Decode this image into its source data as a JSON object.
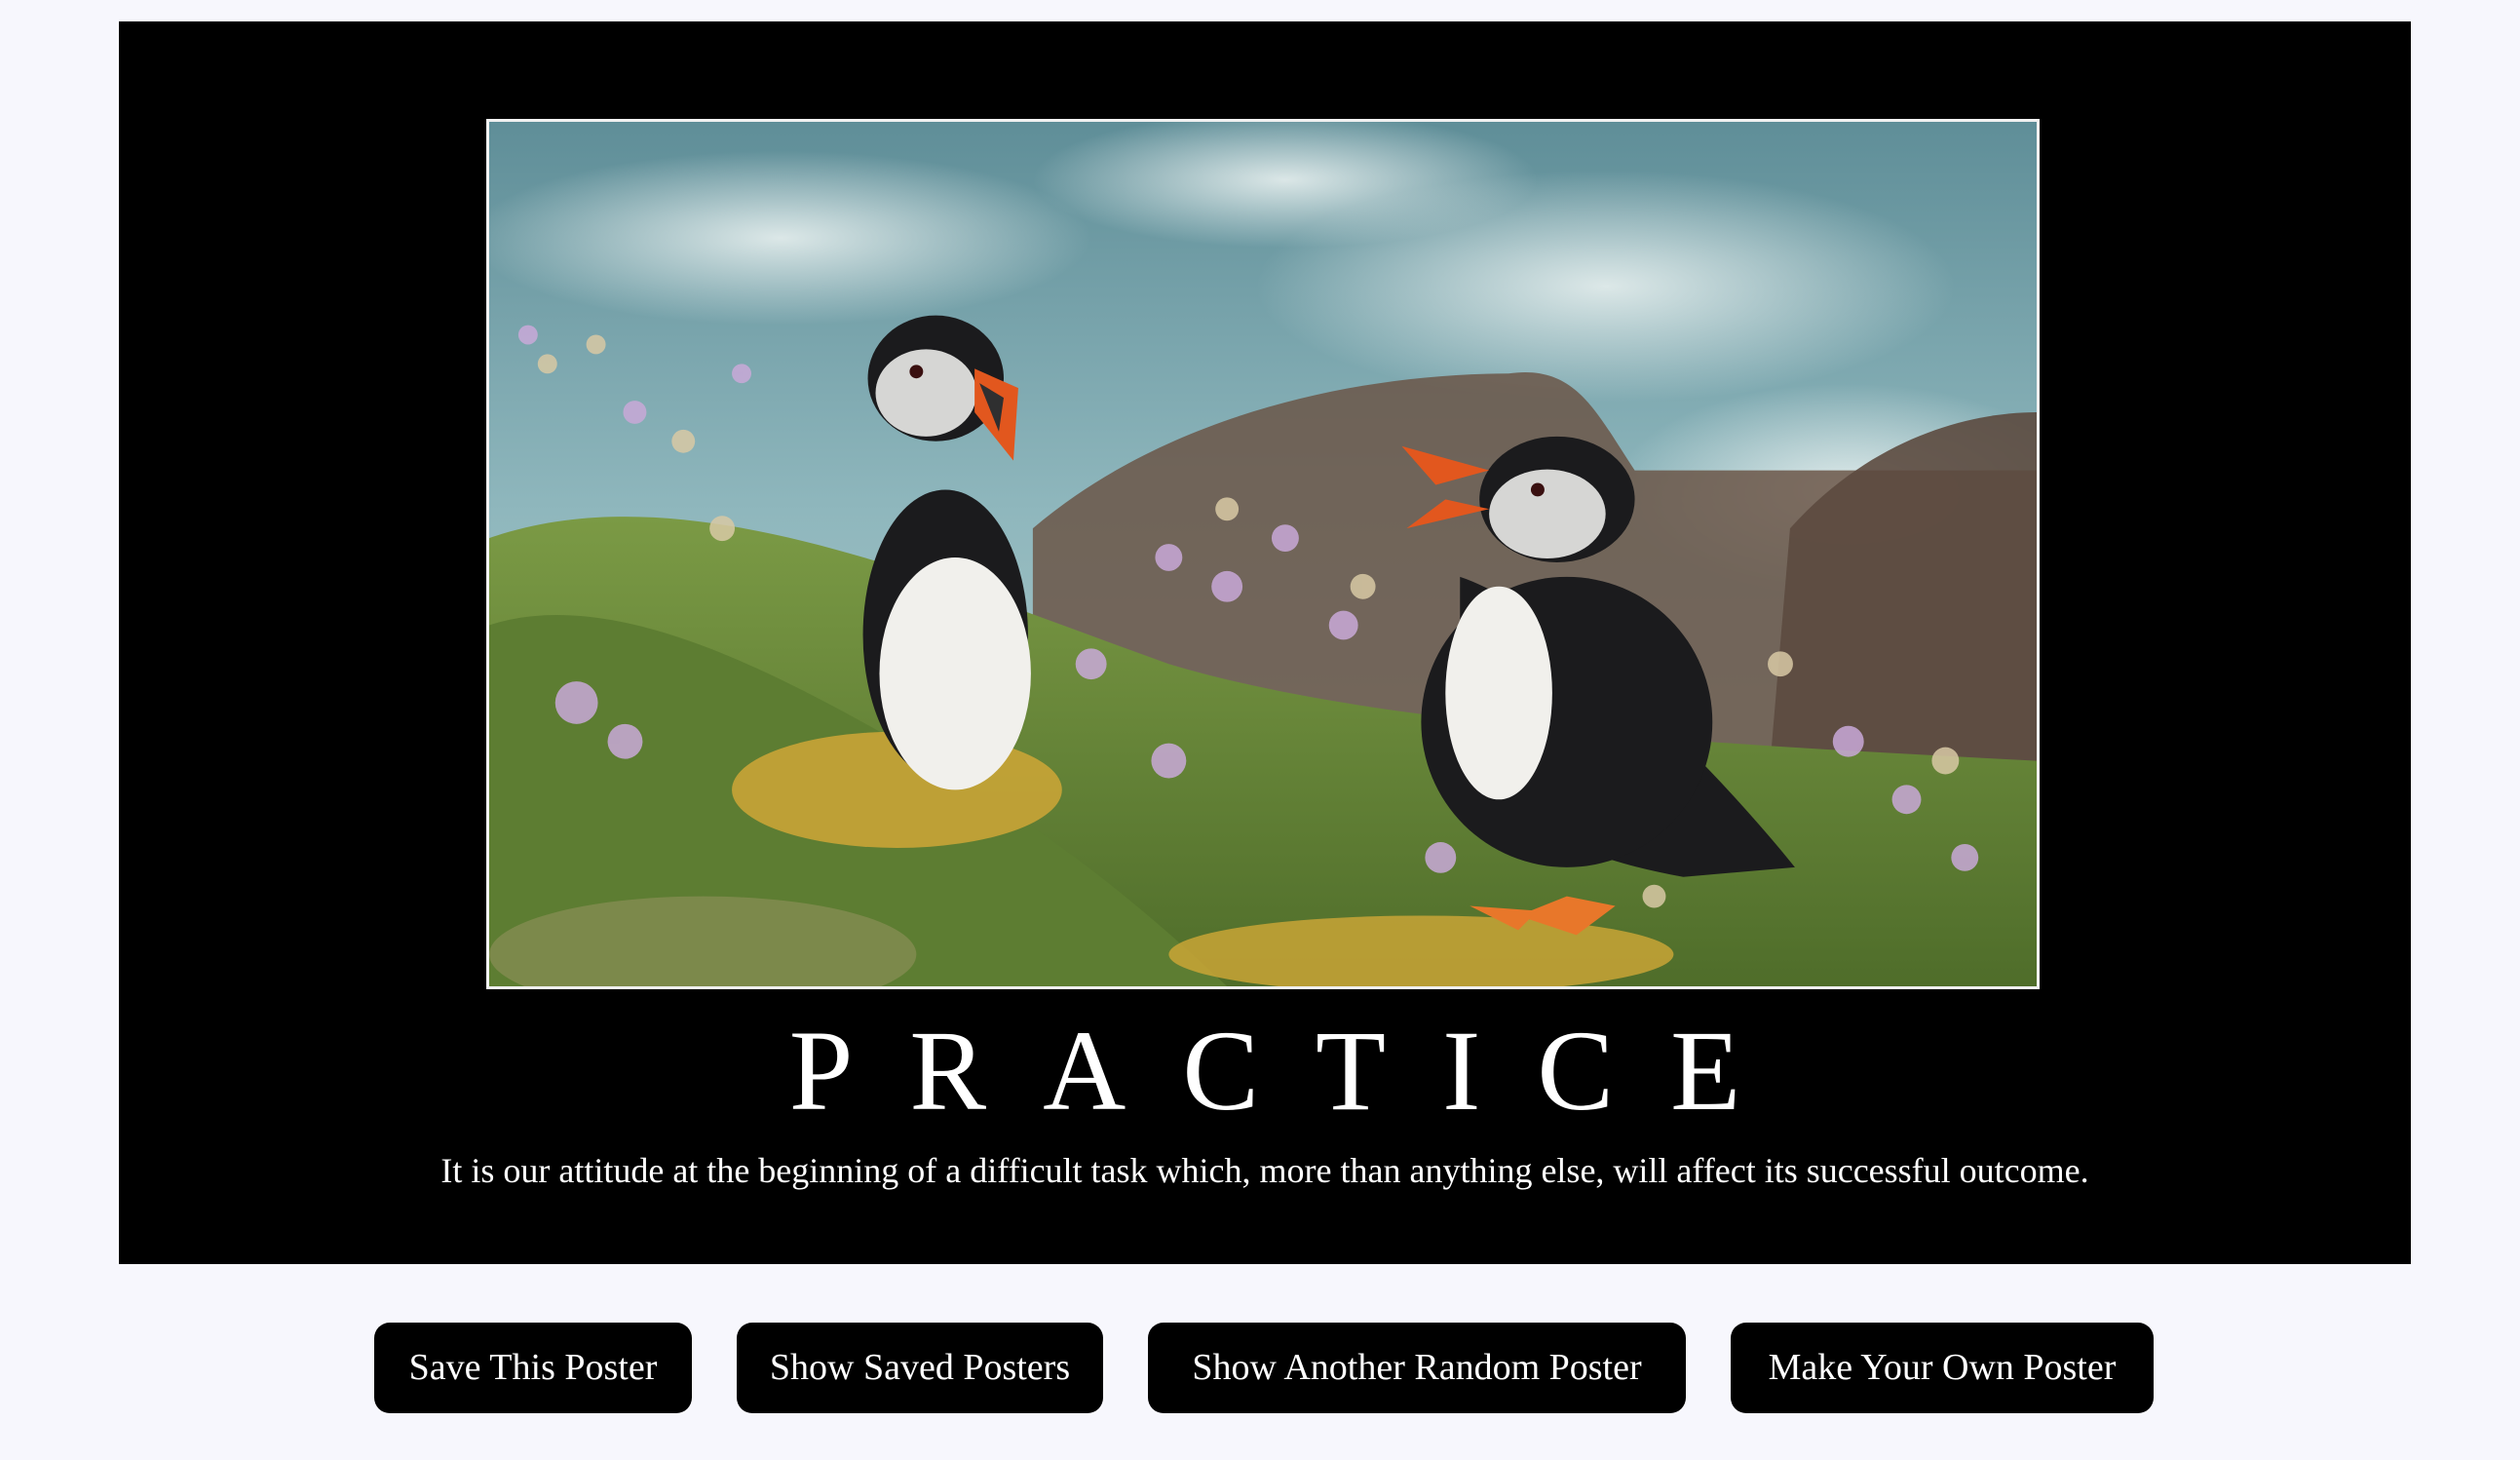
{
  "poster": {
    "title": "PRACTICE",
    "quote": "It is our attitude at the beginning of a difficult task which, more than anything else, will affect its successful outcome.",
    "image_subject": "two puffins among pink sea thrift flowers on a grassy cliff with sea behind"
  },
  "controls": {
    "save_label": "Save This Poster",
    "show_saved_label": "Show Saved Posters",
    "random_label": "Show Another Random Poster",
    "make_own_label": "Make Your Own Poster"
  },
  "colors": {
    "page_background": "#f7f7fd",
    "poster_background": "#000000",
    "button_background": "#000000",
    "text": "#ffffff"
  }
}
